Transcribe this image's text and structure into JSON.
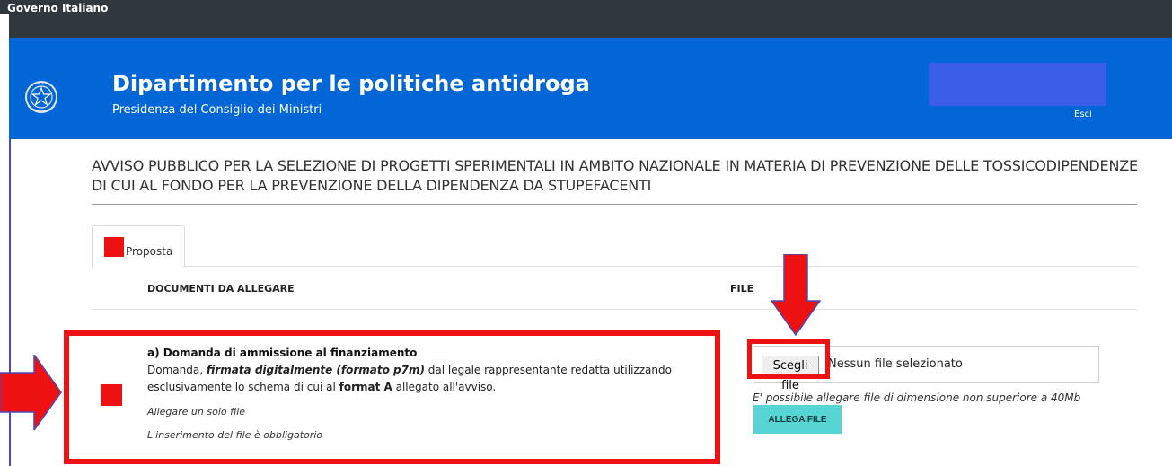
{
  "topbar": {
    "label": "Governo Italiano"
  },
  "header": {
    "title": "Dipartimento per le politiche antidroga",
    "subtitle": "Presidenza del Consiglio dei Ministri",
    "logout_label": "Esci",
    "colors": {
      "bar": "#0266d6",
      "topbar": "#30373d"
    }
  },
  "notice": {
    "title": "AVVISO PUBBLICO PER LA SELEZIONE DI PROGETTI SPERIMENTALI IN AMBITO NAZIONALE IN MATERIA DI PREVENZIONE DELLE TOSSICODIPENDENZE DI CUI AL FONDO PER LA PREVENZIONE DELLA DIPENDENZA DA STUPEFACENTI"
  },
  "tabs": [
    {
      "label": "Proposta",
      "status_color": "#ee1111"
    }
  ],
  "table": {
    "headers": {
      "documents": "DOCUMENTI DA ALLEGARE",
      "file": "FILE"
    }
  },
  "document": {
    "title": "a) Domanda di ammissione al finanziamento",
    "desc_part1": "Domanda, ",
    "desc_emph": "firmata digitalmente (formato p7m)",
    "desc_part2": " dal legale rappresentante redatta utilizzando esclusivamente lo schema di cui al ",
    "desc_bold": "format A",
    "desc_part3": " allegato all'avviso.",
    "note_single": "Allegare un solo file",
    "note_required": "L'inserimento del file è obbligatorio"
  },
  "upload": {
    "choose_label": "Scegli file",
    "no_file_label": "Nessun file selezionato",
    "size_note": "E' possibile allegare file di dimensione non superiore a 40Mb",
    "attach_label": "ALLEGA FILE",
    "attach_color": "#56d5d4"
  },
  "annotation_color": "#ee1111"
}
